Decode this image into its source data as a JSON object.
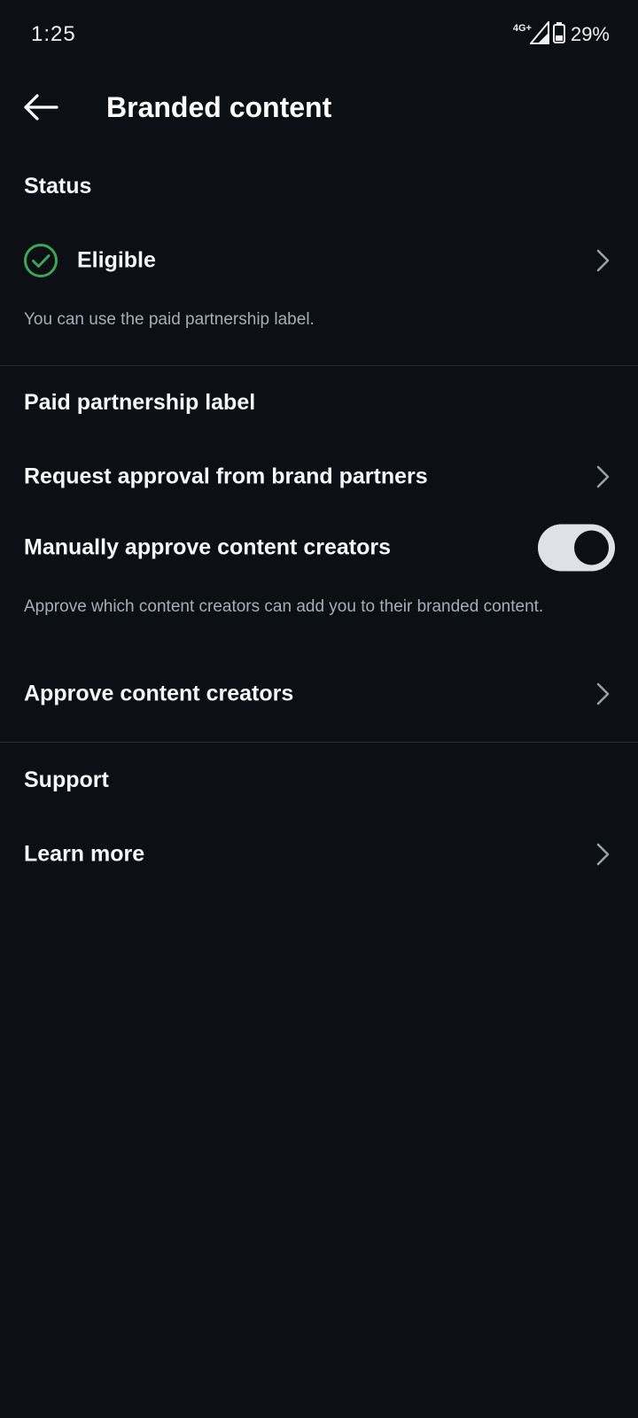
{
  "status_bar": {
    "time": "1:25",
    "network": "4G+",
    "battery": "29%"
  },
  "header": {
    "title": "Branded content"
  },
  "status_section": {
    "header": "Status",
    "status_label": "Eligible",
    "caption": "You can use the paid partnership label."
  },
  "partnership_section": {
    "header": "Paid partnership label",
    "request_approval_label": "Request approval from brand partners",
    "manual_approve_label": "Manually approve content creators",
    "manual_approve_enabled": true,
    "manual_approve_caption": "Approve which content creators can add you to their branded content.",
    "approve_creators_label": "Approve content creators"
  },
  "support_section": {
    "header": "Support",
    "learn_more_label": "Learn more"
  },
  "colors": {
    "background": "#0c0f14",
    "eligible_green": "#3aa756",
    "toggle_track": "#dfe1e6",
    "caption_text": "#a7adb8"
  }
}
